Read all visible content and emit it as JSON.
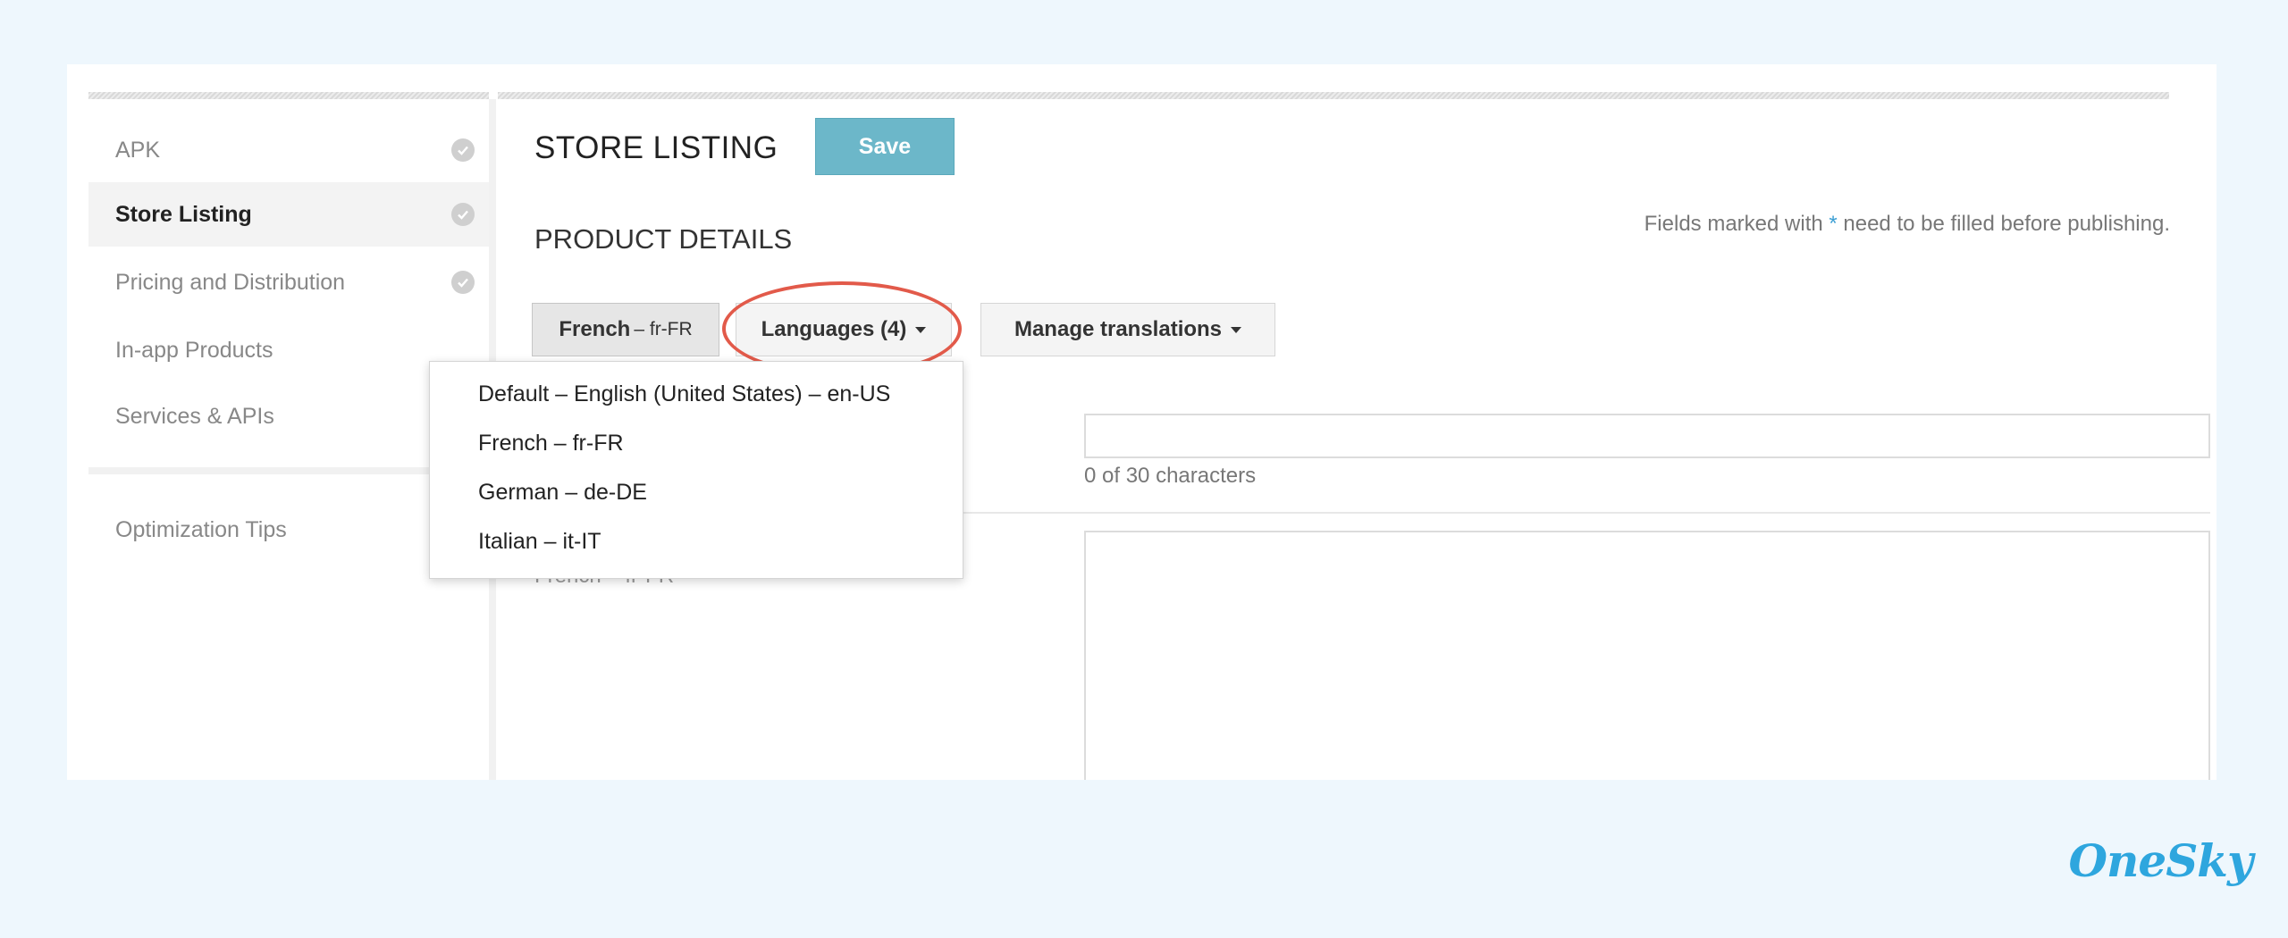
{
  "sidebar": {
    "items": [
      {
        "label": "APK",
        "check": true
      },
      {
        "label": "Store Listing",
        "check": true
      },
      {
        "label": "Pricing and Distribution",
        "check": true
      },
      {
        "label": "In-app Products",
        "check": false
      },
      {
        "label": "Services & APIs",
        "check": false
      }
    ],
    "tips": "Optimization Tips"
  },
  "header": {
    "title": "STORE LISTING",
    "save_label": "Save"
  },
  "product": {
    "section_title": "PRODUCT DETAILS",
    "fields_note_prefix": "Fields marked with ",
    "fields_note_star": "*",
    "fields_note_suffix": " need to be filled before publishing."
  },
  "language_bar": {
    "active_lang": "French",
    "active_code": "– fr-FR",
    "languages_label": "Languages (4)",
    "manage_label": "Manage translations"
  },
  "form": {
    "title_value": "",
    "char_count": "0 of 30 characters",
    "desc_label": "French – fr-FR"
  },
  "dropdown": {
    "items": [
      "Default – English (United States) – en-US",
      "French – fr-FR",
      "German – de-DE",
      "Italian – it-IT"
    ]
  },
  "brand": "OneSky",
  "colors": {
    "background": "#eef7fd",
    "save_button": "#6cb7c9",
    "highlight": "#e25a4a",
    "brand": "#2ea6de"
  }
}
